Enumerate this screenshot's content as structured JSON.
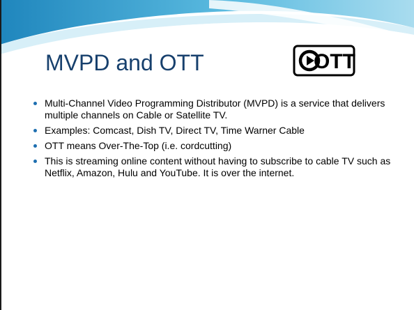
{
  "slide": {
    "title": "MVPD and OTT",
    "logo_text": "OTT",
    "bullets": [
      "Multi-Channel Video Programming Distributor (MVPD) is a service that delivers multiple channels on Cable or Satellite TV.",
      "Examples: Comcast, Dish TV, Direct TV, Time Warner Cable",
      "OTT means Over-The-Top (i.e. cordcutting)",
      "This is streaming online content without having to subscribe to cable TV such as Netflix, Amazon, Hulu and YouTube. It is over the internet."
    ]
  },
  "colors": {
    "title": "#17406d",
    "bullet_dot": "#1e6fb0",
    "wave_dark": "#1f8fc4",
    "wave_light": "#bfe6f4"
  }
}
